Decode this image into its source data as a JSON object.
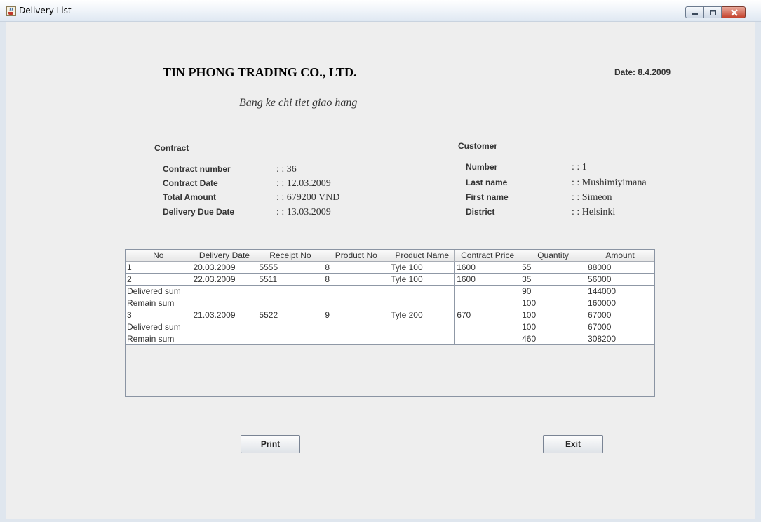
{
  "window": {
    "title": "Delivery List"
  },
  "header": {
    "company": "TIN PHONG TRADING CO., LTD.",
    "date": "Date: 8.4.2009",
    "subtitle": "Bang ke chi tiet giao hang"
  },
  "contract": {
    "heading": "Contract",
    "fields": [
      {
        "label": "Contract number",
        "value": ": : 36"
      },
      {
        "label": "Contract Date",
        "value": ": : 12.03.2009"
      },
      {
        "label": "Total Amount",
        "value": ": : 679200 VND"
      },
      {
        "label": "Delivery Due Date",
        "value": ": : 13.03.2009"
      }
    ]
  },
  "customer": {
    "heading": "Customer",
    "fields": [
      {
        "label": "Number",
        "value": ": : 1"
      },
      {
        "label": "Last name",
        "value": ": : Mushimiyimana"
      },
      {
        "label": "First name",
        "value": ": : Simeon"
      },
      {
        "label": "District",
        "value": ": : Helsinki"
      }
    ]
  },
  "table": {
    "columns": [
      "No",
      "Delivery Date",
      "Receipt No",
      "Product No",
      "Product Name",
      "Contract Price",
      "Quantity",
      "Amount"
    ],
    "rows": [
      [
        "1",
        "20.03.2009",
        "5555",
        "8",
        "Tyle 100",
        "1600",
        "55",
        "88000"
      ],
      [
        "2",
        "22.03.2009",
        "5511",
        "8",
        "Tyle 100",
        "1600",
        "35",
        "56000"
      ],
      [
        "Delivered sum",
        "",
        "",
        "",
        "",
        "",
        "90",
        "144000"
      ],
      [
        "Remain sum",
        "",
        "",
        "",
        "",
        "",
        "100",
        "160000"
      ],
      [
        "3",
        "21.03.2009",
        "5522",
        "9",
        "Tyle 200",
        "670",
        "100",
        "67000"
      ],
      [
        "Delivered sum",
        "",
        "",
        "",
        "",
        "",
        "100",
        "67000"
      ],
      [
        "Remain sum",
        "",
        "",
        "",
        "",
        "",
        "460",
        "308200"
      ]
    ]
  },
  "buttons": {
    "print": "Print",
    "exit": "Exit"
  },
  "colors": {
    "accent_close": "#c4432e",
    "table_border": "#8f98a6",
    "background": "#eeeeee"
  },
  "icons": {
    "app": "java-cup-icon",
    "minimize": "minimize-icon",
    "maximize": "maximize-icon",
    "close": "close-icon"
  }
}
